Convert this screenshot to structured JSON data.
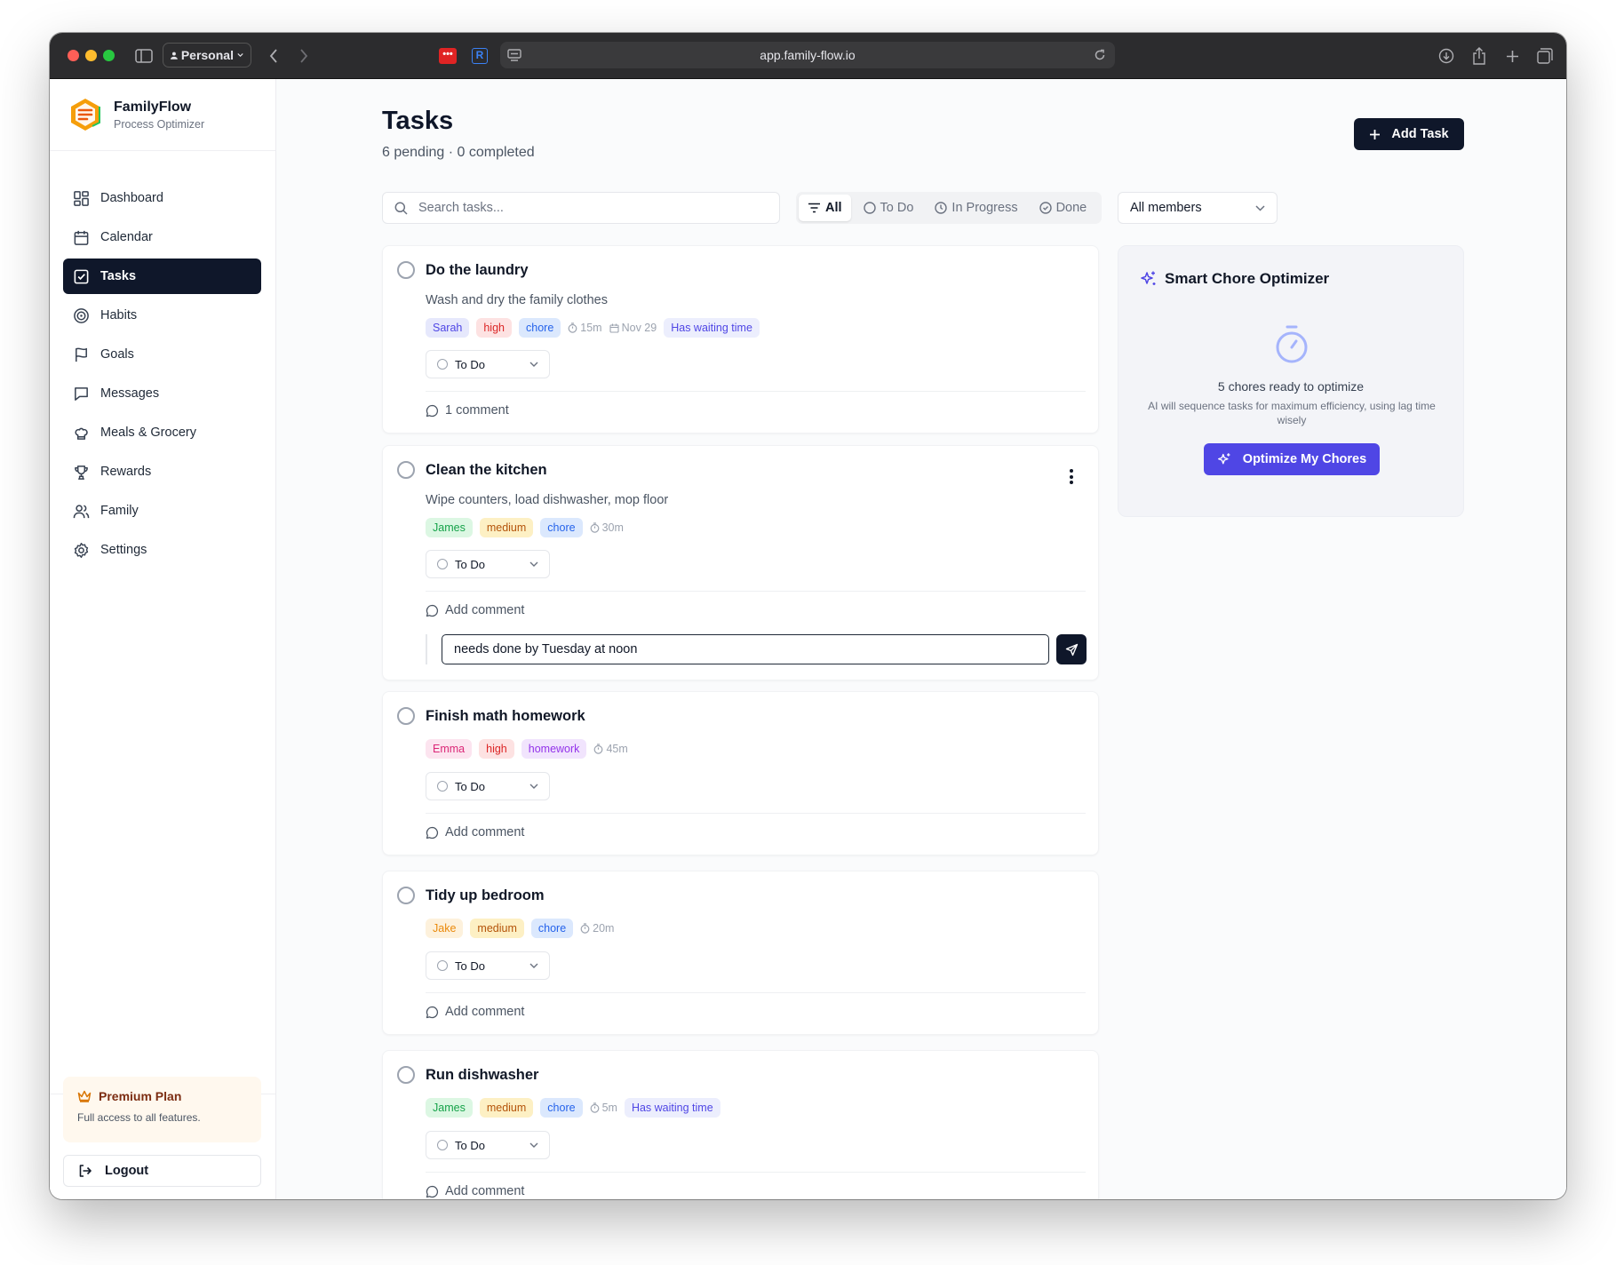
{
  "browser": {
    "profile": "Personal",
    "url": "app.family-flow.io"
  },
  "brand": {
    "name": "FamilyFlow",
    "subtitle": "Process Optimizer"
  },
  "nav": [
    {
      "label": "Dashboard",
      "icon": "dashboard-icon"
    },
    {
      "label": "Calendar",
      "icon": "calendar-icon"
    },
    {
      "label": "Tasks",
      "icon": "tasks-icon",
      "active": true
    },
    {
      "label": "Habits",
      "icon": "target-icon"
    },
    {
      "label": "Goals",
      "icon": "flag-icon"
    },
    {
      "label": "Messages",
      "icon": "message-icon"
    },
    {
      "label": "Meals & Grocery",
      "icon": "chef-hat-icon"
    },
    {
      "label": "Rewards",
      "icon": "trophy-icon"
    },
    {
      "label": "Family",
      "icon": "users-icon"
    },
    {
      "label": "Settings",
      "icon": "gear-icon"
    }
  ],
  "premium": {
    "title": "Premium Plan",
    "subtitle": "Full access to all features."
  },
  "logout_label": "Logout",
  "page": {
    "title": "Tasks",
    "subtitle": "6 pending · 0 completed",
    "add_task_label": "Add Task",
    "search_placeholder": "Search tasks..."
  },
  "filters": [
    "All",
    "To Do",
    "In Progress",
    "Done"
  ],
  "members_select": "All members",
  "tasks": [
    {
      "title": "Do the laundry",
      "description": "Wash and dry the family clothes",
      "assignee": "Sarah",
      "priority": "high",
      "category": "chore",
      "duration": "15m",
      "due": "Nov 29",
      "waiting": "Has waiting time",
      "status": "To Do",
      "comment": "1 comment"
    },
    {
      "title": "Clean the kitchen",
      "description": "Wipe counters, load dishwasher, mop floor",
      "assignee": "James",
      "priority": "medium",
      "category": "chore",
      "duration": "30m",
      "status": "To Do",
      "comment": "Add comment",
      "comment_input": "needs done by Tuesday at noon"
    },
    {
      "title": "Finish math homework",
      "assignee": "Emma",
      "priority": "high",
      "category": "homework",
      "duration": "45m",
      "status": "To Do",
      "comment": "Add comment"
    },
    {
      "title": "Tidy up bedroom",
      "assignee": "Jake",
      "priority": "medium",
      "category": "chore",
      "duration": "20m",
      "status": "To Do",
      "comment": "Add comment"
    },
    {
      "title": "Run dishwasher",
      "assignee": "James",
      "priority": "medium",
      "category": "chore",
      "duration": "5m",
      "waiting": "Has waiting time",
      "status": "To Do",
      "comment": "Add comment"
    }
  ],
  "optimizer": {
    "title": "Smart Chore Optimizer",
    "ready": "5 chores ready to optimize",
    "description": "AI will sequence tasks for maximum efficiency, using lag time wisely",
    "button": "Optimize My Chores"
  },
  "colors": {
    "primary": "#0f172a",
    "accent": "#4f46e5",
    "high_bg": "#fde2e2",
    "high_fg": "#dc2626",
    "medium_bg": "#fdf0c4",
    "medium_fg": "#b45309",
    "chore_bg": "#dbe8fd",
    "chore_fg": "#2563eb",
    "homework_bg": "#f1e4fd",
    "homework_fg": "#9333ea",
    "waiting_bg": "#eceefd",
    "waiting_fg": "#4f46e5"
  }
}
